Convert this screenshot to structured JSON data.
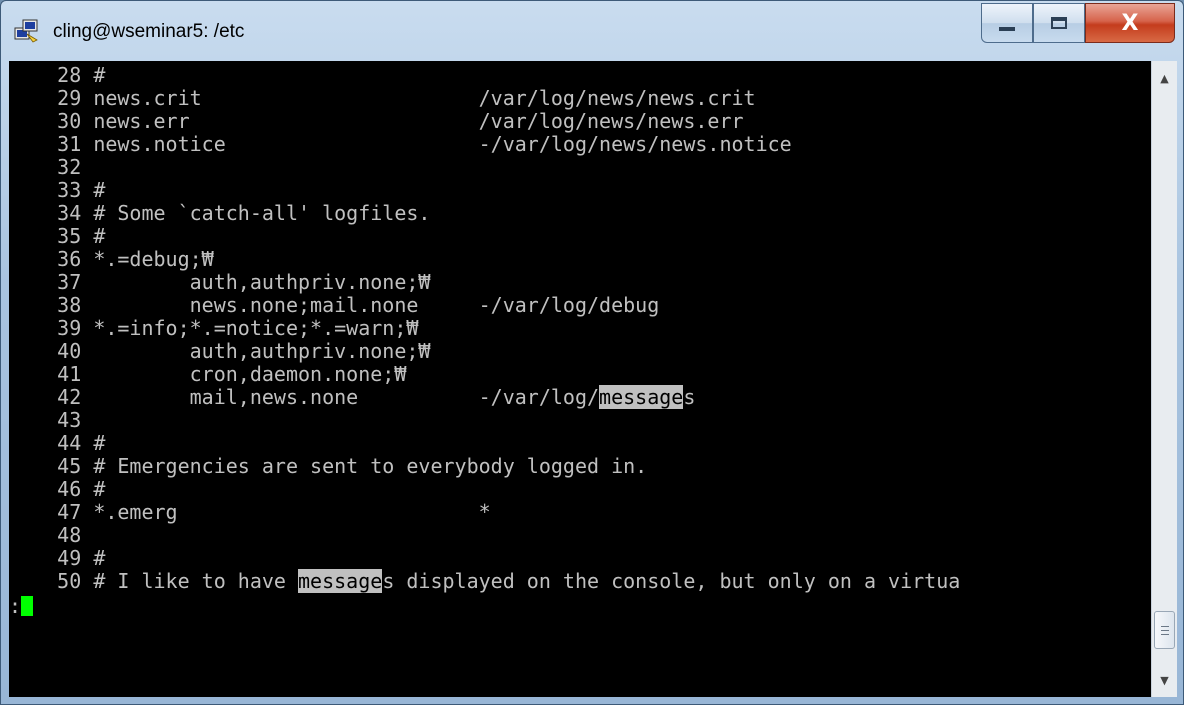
{
  "window": {
    "title": "cling@wseminar5: /etc"
  },
  "caption": {
    "close_label": "X"
  },
  "terminal": {
    "lines": [
      {
        "no": "28",
        "text": "#"
      },
      {
        "no": "29",
        "text": "news.crit                       /var/log/news/news.crit"
      },
      {
        "no": "30",
        "text": "news.err                        /var/log/news/news.err"
      },
      {
        "no": "31",
        "text": "news.notice                     -/var/log/news/news.notice"
      },
      {
        "no": "32",
        "text": ""
      },
      {
        "no": "33",
        "text": "#"
      },
      {
        "no": "34",
        "text": "# Some `catch-all' logfiles."
      },
      {
        "no": "35",
        "text": "#"
      },
      {
        "no": "36",
        "text": "*.=debug;₩"
      },
      {
        "no": "37",
        "text": "        auth,authpriv.none;₩"
      },
      {
        "no": "38",
        "text": "        news.none;mail.none     -/var/log/debug"
      },
      {
        "no": "39",
        "text": "*.=info;*.=notice;*.=warn;₩"
      },
      {
        "no": "40",
        "text": "        auth,authpriv.none;₩"
      },
      {
        "no": "41",
        "text": "        cron,daemon.none;₩"
      },
      {
        "no": "42",
        "pre": "        mail,news.none          -/var/log/",
        "hl": "message",
        "post": "s"
      },
      {
        "no": "43",
        "text": ""
      },
      {
        "no": "44",
        "text": "#"
      },
      {
        "no": "45",
        "text": "# Emergencies are sent to everybody logged in."
      },
      {
        "no": "46",
        "text": "#"
      },
      {
        "no": "47",
        "text": "*.emerg                         *"
      },
      {
        "no": "48",
        "text": ""
      },
      {
        "no": "49",
        "text": "#"
      },
      {
        "no": "50",
        "pre": "# I like to have ",
        "hl": "message",
        "post": "s displayed on the console, but only on a virtua"
      }
    ],
    "command_line": ":"
  },
  "colors": {
    "terminal_bg": "#000000",
    "terminal_fg": "#c0c0c0",
    "cursor": "#00ff00",
    "highlight_bg": "#c0c0c0"
  }
}
